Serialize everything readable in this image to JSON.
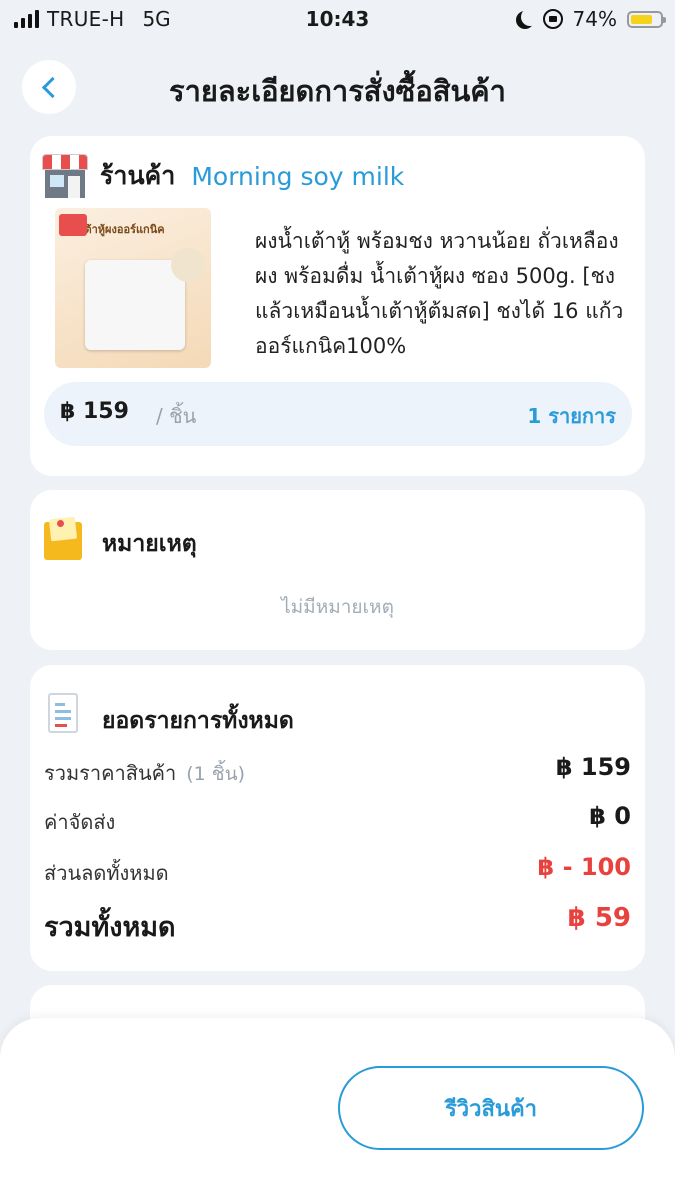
{
  "status_bar": {
    "carrier": "TRUE-H",
    "network": "5G",
    "time": "10:43",
    "battery": "74%",
    "battery_level": 0.74
  },
  "header": {
    "title": "รายละเอียดการสั่งซื้อสินค้า"
  },
  "shop": {
    "label": "ร้านค้า",
    "name": "Morning soy milk",
    "product_image_text": "น้ำเต้าหู้ผงออร์แกนิค",
    "product_description": "ผงน้ำเต้าหู้ พร้อมชง หวานน้อย ถั่วเหลืองผง พร้อมดื่ม น้ำเต้าหู้ผง ซอง 500g. [ชงแล้วเหมือนน้ำเต้าหู้ต้มสด] ชงได้ 16 แก้ว ออร์แกนิค100%",
    "price": "฿ 159",
    "price_unit": "/ ชิ้น",
    "quantity": "1 รายการ"
  },
  "note": {
    "title": "หมายเหตุ",
    "empty_text": "ไม่มีหมายเหตุ"
  },
  "summary": {
    "title": "ยอดรายการทั้งหมด",
    "subtotal_label": "รวมราคาสินค้า",
    "subtotal_count": "(1 ชิ้น)",
    "subtotal_value": "฿ 159",
    "shipping_label": "ค่าจัดส่ง",
    "shipping_value": "฿ 0",
    "discount_label": "ส่วนลดทั้งหมด",
    "discount_value": "฿ - 100",
    "grand_total_label": "รวมทั้งหมด",
    "grand_total_value": "฿ 59"
  },
  "actions": {
    "review_label": "รีวิวสินค้า"
  },
  "colors": {
    "accent": "#2a9bd9",
    "discount": "#e8423f",
    "background": "#eef2f7"
  }
}
